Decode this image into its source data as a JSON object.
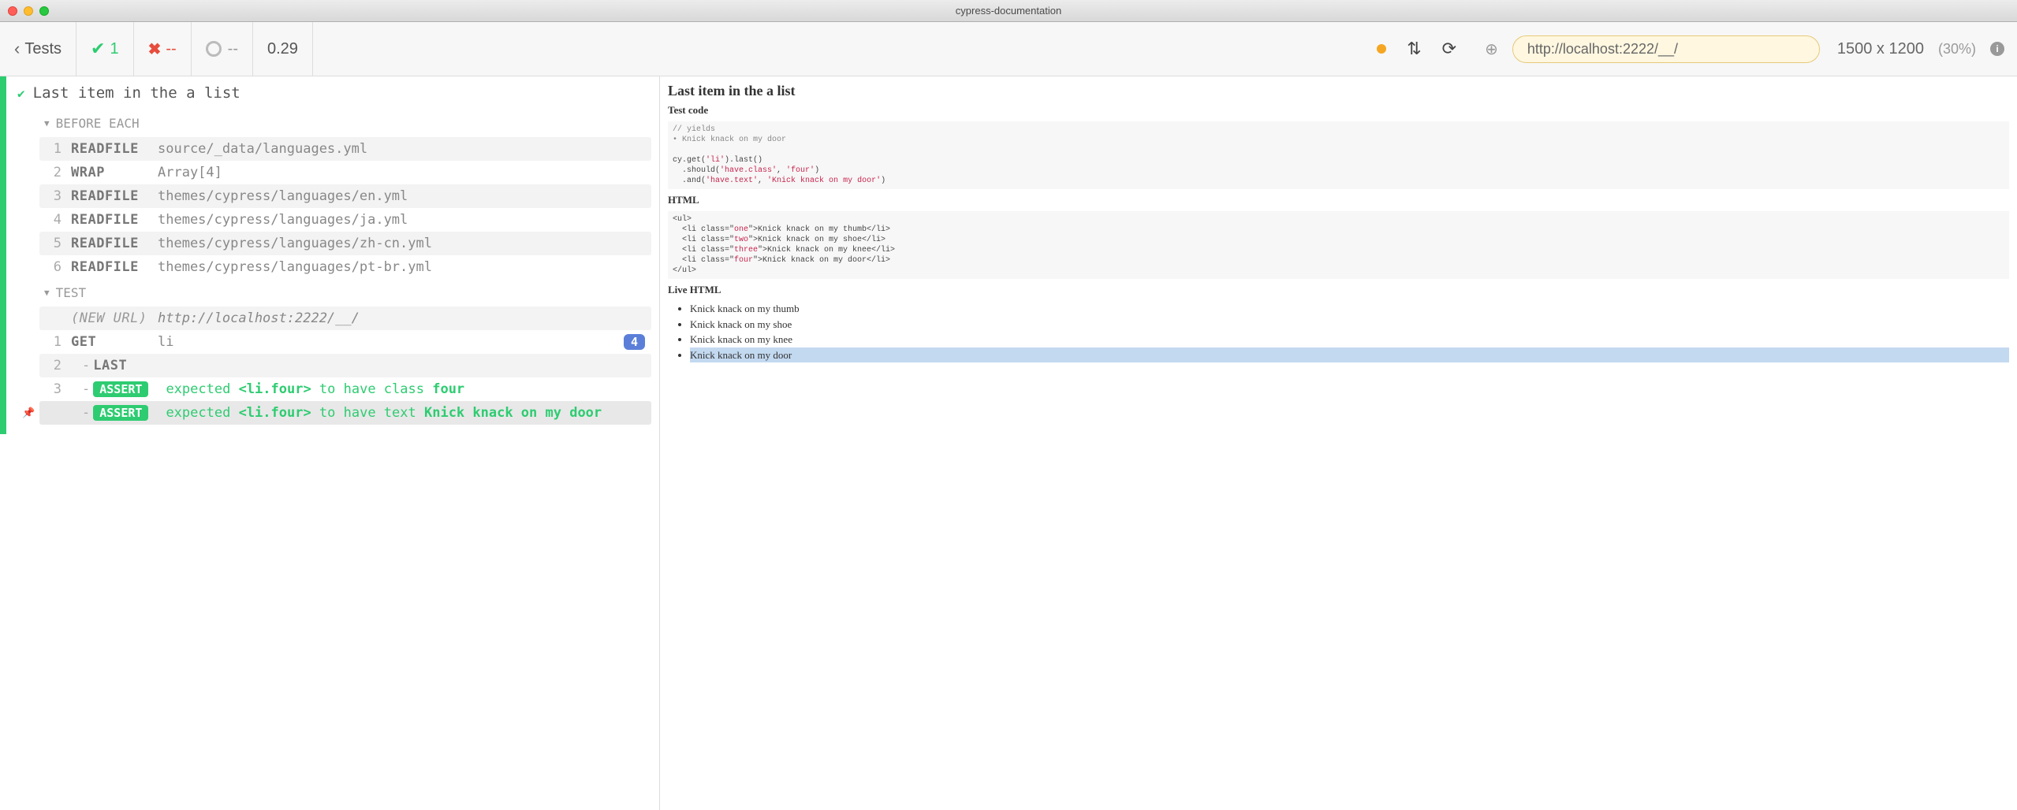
{
  "window_title": "cypress-documentation",
  "header": {
    "back_label": "Tests",
    "passed": "1",
    "failed": "--",
    "pending": "--",
    "duration": "0.29"
  },
  "urlbar": {
    "url": "http://localhost:2222/__/",
    "viewport": "1500 x 1200",
    "zoom": "(30%)"
  },
  "test": {
    "title": "Last item in the a list"
  },
  "sections": {
    "before_each": "BEFORE EACH",
    "test": "TEST"
  },
  "before_commands": [
    {
      "num": "1",
      "name": "READFILE",
      "msg": "source/_data/languages.yml"
    },
    {
      "num": "2",
      "name": "WRAP",
      "msg": "Array[4]"
    },
    {
      "num": "3",
      "name": "READFILE",
      "msg": "themes/cypress/languages/en.yml"
    },
    {
      "num": "4",
      "name": "READFILE",
      "msg": "themes/cypress/languages/ja.yml"
    },
    {
      "num": "5",
      "name": "READFILE",
      "msg": "themes/cypress/languages/zh-cn.yml"
    },
    {
      "num": "6",
      "name": "READFILE",
      "msg": "themes/cypress/languages/pt-br.yml"
    }
  ],
  "test_commands": {
    "new_url_label": "(NEW URL)",
    "new_url": "http://localhost:2222/__/",
    "get_num": "1",
    "get_name": "GET",
    "get_msg": "li",
    "get_count": "4",
    "last_num": "2",
    "last_name": "LAST",
    "assert1_num": "3",
    "assert1_msg_pre": "expected ",
    "assert1_subject": "<li.four>",
    "assert1_mid": " to have class ",
    "assert1_val": "four",
    "assert2_msg_pre": "expected ",
    "assert2_subject": "<li.four>",
    "assert2_mid": " to have text ",
    "assert2_val": "Knick knack on my door",
    "assert_label": "ASSERT"
  },
  "aut": {
    "h2": "Last item in the a list",
    "test_code_h": "Test code",
    "test_code_lines": {
      "c1": "// yields",
      "c2": "• Knick knack on my door",
      "l1": "cy.get(",
      "s1": "'li'",
      "l1b": ").last()",
      "l2": "  .should(",
      "s2": "'have.class'",
      "l2b": ", ",
      "s3": "'four'",
      "l2c": ")",
      "l3": "  .and(",
      "s4": "'have.text'",
      "l3b": ", ",
      "s5": "'Knick knack on my door'",
      "l3c": ")"
    },
    "html_h": "HTML",
    "html_lines": {
      "open": "<ul>",
      "li1a": "  <li class=\"",
      "li1cls": "one",
      "li1b": "\">Knick knack on my thumb</li>",
      "li2a": "  <li class=\"",
      "li2cls": "two",
      "li2b": "\">Knick knack on my shoe</li>",
      "li3a": "  <li class=\"",
      "li3cls": "three",
      "li3b": "\">Knick knack on my knee</li>",
      "li4a": "  <li class=\"",
      "li4cls": "four",
      "li4b": "\">Knick knack on my door</li>",
      "close": "</ul>"
    },
    "live_h": "Live HTML",
    "live_items": [
      "Knick knack on my thumb",
      "Knick knack on my shoe",
      "Knick knack on my knee",
      "Knick knack on my door"
    ]
  }
}
